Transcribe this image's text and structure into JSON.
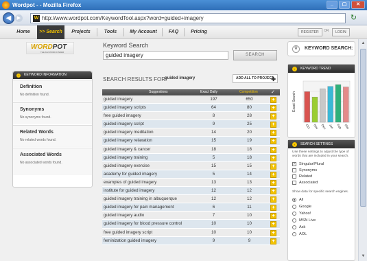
{
  "window": {
    "title": "Wordpot - - Mozilla Firefox",
    "buttons": [
      "_",
      "▢",
      "✕"
    ]
  },
  "browser": {
    "url": "http://www.wordpot.com/KeywordTool.aspx?word=guided+imagery",
    "back": "◀",
    "forward": "▶",
    "reload": "↻",
    "favicon": "W"
  },
  "nav": {
    "items": [
      "Home",
      ">> Search",
      "Projects",
      "Tools",
      "My Account",
      "FAQ",
      "Pricing"
    ],
    "register": "REGISTER",
    "or": "OR",
    "login": "LOGIN"
  },
  "logo": {
    "text_a": "WORD",
    "text_b": "POT",
    "tagline": "THE KEYWORD FINDER"
  },
  "left": {
    "header": "KEYWORD INFORMATION",
    "sections": [
      {
        "title": "Definition",
        "text": "No definition found."
      },
      {
        "title": "Synonyms",
        "text": "No synonyms found."
      },
      {
        "title": "Related Words",
        "text": "No related words found."
      },
      {
        "title": "Associated Words",
        "text": "No associated words found."
      }
    ]
  },
  "search": {
    "label": "Keyword Search",
    "value": "guided imagery",
    "button": "SEARCH"
  },
  "results": {
    "label": "SEARCH RESULTS FOR:",
    "term": "guided imagery",
    "add_all": "ADD ALL TO PROJECT",
    "columns": [
      "Suggestions",
      "Exact Daily",
      "Competition"
    ],
    "rows": [
      {
        "s": "guided imagery",
        "e": "197",
        "g": "650"
      },
      {
        "s": "guided imagery scripts",
        "e": "64",
        "g": "80"
      },
      {
        "s": "free guided imagery",
        "e": "8",
        "g": "28"
      },
      {
        "s": "guided imagery script",
        "e": "9",
        "g": "25"
      },
      {
        "s": "guided imagery meditation",
        "e": "14",
        "g": "20"
      },
      {
        "s": "guided imagery relaxation",
        "e": "15",
        "g": "19"
      },
      {
        "s": "guided imagery & cancer",
        "e": "18",
        "g": "18"
      },
      {
        "s": "guided imagery training",
        "e": "5",
        "g": "18"
      },
      {
        "s": "guided imagery exercise",
        "e": "15",
        "g": "15"
      },
      {
        "s": "academy for guided imagery",
        "e": "5",
        "g": "14"
      },
      {
        "s": "examples of guided imagery",
        "e": "13",
        "g": "13"
      },
      {
        "s": "institute for guided imagery",
        "e": "12",
        "g": "12"
      },
      {
        "s": "guided imagery training in albuquerque",
        "e": "12",
        "g": "12"
      },
      {
        "s": "guided imagery for pain management",
        "e": "6",
        "g": "11"
      },
      {
        "s": "guided imagery audio",
        "e": "7",
        "g": "10"
      },
      {
        "s": "guided imagery for blood pressure control",
        "e": "10",
        "g": "10"
      },
      {
        "s": "free guided imagery script",
        "e": "10",
        "g": "10"
      },
      {
        "s": "feminization guided imagery",
        "e": "9",
        "g": "9"
      }
    ]
  },
  "right": {
    "kw_search": "KEYWORD SEARCH:",
    "trend_header": "KEYWORD TREND",
    "settings_header": "SEARCH SETTINGS",
    "settings_text": "Use these settings to adjust the type of words that are included in your search.",
    "checks": [
      {
        "label": "Singular/Plural",
        "checked": true
      },
      {
        "label": "Synonyms",
        "checked": false
      },
      {
        "label": "Related",
        "checked": false
      },
      {
        "label": "Associated",
        "checked": false
      }
    ],
    "engines_text": "Show data for specific search engines.",
    "engines": [
      {
        "label": "All",
        "selected": true
      },
      {
        "label": "Google",
        "selected": false
      },
      {
        "label": "Yahoo!",
        "selected": false
      },
      {
        "label": "MSN Live",
        "selected": false
      },
      {
        "label": "Ask",
        "selected": false
      },
      {
        "label": "AOL",
        "selected": false
      }
    ]
  },
  "chart_data": {
    "type": "bar",
    "categories": [
      "Oct",
      "Nov",
      "Dec",
      "Jan",
      "Feb",
      "Mar"
    ],
    "values": [
      520,
      430,
      570,
      610,
      640,
      600
    ],
    "ylabel": "Exact Search",
    "colors": [
      "#d9534f",
      "#9acd32",
      "#c8c8c8",
      "#3cb8d6",
      "#2fb07a",
      "#e58a8a"
    ],
    "ylim": [
      0,
      700
    ]
  }
}
